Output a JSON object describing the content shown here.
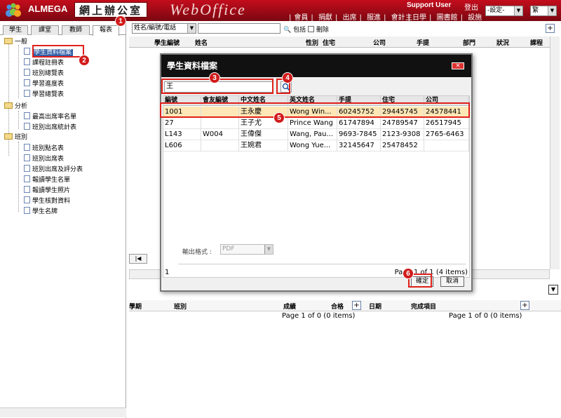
{
  "header": {
    "brand": "ALMEGA",
    "brand_cn": "網上辦公室",
    "product": "WebOffice",
    "user": "Support User",
    "logout": "登出",
    "nav_row1": [
      "會員",
      "捐獻",
      "出席",
      "服進",
      "會計"
    ],
    "nav_row2": [
      "主日學",
      "圖書館",
      "設施"
    ],
    "settings_select": "-設定-",
    "lang_select": "繁"
  },
  "left": {
    "tabs": [
      "學生",
      "課堂",
      "教師",
      "報表"
    ],
    "tree": {
      "group1": "一般",
      "items1": [
        "學生資料檔案",
        "課程註冊表",
        "班別總覽表",
        "學習進度表",
        "學習總覽表"
      ],
      "group2": "分析",
      "items2": [
        "最高出席率名單",
        "班別出席統計表"
      ],
      "group3": "班別",
      "items3": [
        "班別點名表",
        "班別出席表",
        "班別出席及評分表",
        "報讀學生名單",
        "報讀學生照片",
        "學生核對資料",
        "學生名牌"
      ]
    }
  },
  "main": {
    "field_select": "姓名/編號/電話",
    "include_label": "包括",
    "deleted_label": "刪除",
    "columns": [
      "學生編號",
      "姓名",
      "性別",
      "住宅",
      "公司",
      "手提",
      "部門",
      "狀況",
      "課程"
    ],
    "lower_left_columns": [
      "學期",
      "班別",
      "成績",
      "合格"
    ],
    "lower_right_columns": [
      "日期",
      "完成項目"
    ],
    "lower_left_pager": "Page 1 of 0 (0 items)",
    "lower_right_pager": "Page 1 of 0 (0 items)",
    "pager_first": "|◀"
  },
  "dialog": {
    "title": "學生資料檔案",
    "search_value": "王",
    "columns": [
      "編號",
      "會友編號",
      "中文姓名",
      "英文姓名",
      "手提",
      "住宅",
      "公司"
    ],
    "rows": [
      [
        "1001",
        "",
        "王永慶",
        "Wong Win...",
        "60245752",
        "29445745",
        "24578441"
      ],
      [
        "27",
        "",
        "王子尤",
        "Prince Wang",
        "61747894",
        "24789547",
        "26517945"
      ],
      [
        "L143",
        "W004",
        "王偉傑",
        "Wang, Pau...",
        "9693-7845",
        "2123-9308",
        "2765-6463"
      ],
      [
        "L606",
        "",
        "王婉君",
        "Wong Yue...",
        "32145647",
        "25478452",
        ""
      ]
    ],
    "footer_left": "1",
    "footer_right": "Page 1 of 1 (4 items)",
    "export_label": "輸出格式 :",
    "export_value": "PDF",
    "ok_label": "確定",
    "cancel_label": "取消"
  },
  "annotations": [
    "1",
    "2",
    "3",
    "4",
    "5",
    "6"
  ],
  "colors": {
    "header_red": "#c40d1d",
    "selected_row": "#fde7b6",
    "marker_red": "#d11b1b"
  }
}
